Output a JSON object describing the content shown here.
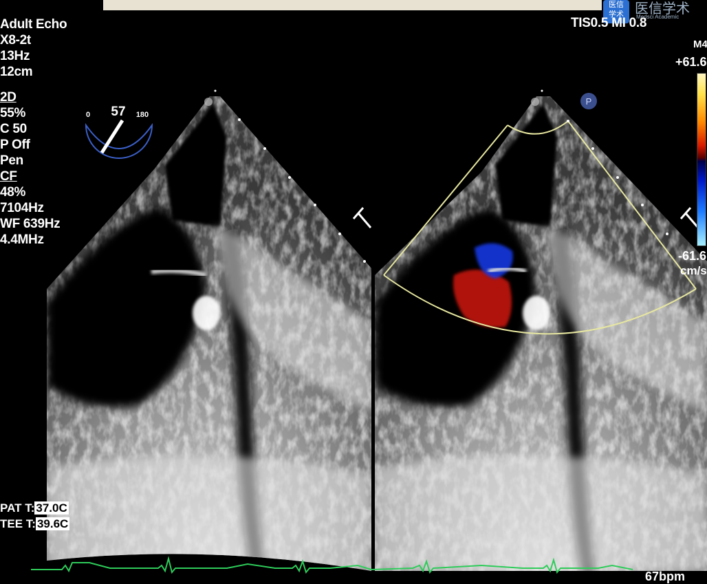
{
  "header": {
    "logo_glyph": "医信学术",
    "logo_text": "医信学术",
    "logo_sub": "Medsci Academic"
  },
  "left_params": {
    "mode": "Adult Echo",
    "probe": "X8-2t",
    "frame_rate": "13Hz",
    "depth": "12cm",
    "section_2d": "2D",
    "gain_2d": " 55%",
    "compress": "C 50",
    "persist": "P Off",
    "resolution": "Pen",
    "section_cf": "CF",
    "gain_cf": " 48%",
    "prf": " 7104Hz",
    "wall_filter": "WF 639Hz",
    "cf_freq": "4.4MHz"
  },
  "top_right": {
    "tis_mi": "TIS0.5   MI 0.8",
    "map": "M4",
    "velocity_top": "+61.6",
    "velocity_bottom": "-61.6",
    "velocity_unit": "cm/s"
  },
  "protractor": {
    "min": "0",
    "angle": "57",
    "max": "180"
  },
  "marker_p": "P",
  "temperatures": {
    "pat_label": "PAT T:",
    "pat_value": "37.0C",
    "tee_label": "TEE T:",
    "tee_value": "39.6C"
  },
  "ecg": {
    "heart_rate": "67bpm",
    "color": "#2ecc5a"
  },
  "colors": {
    "sector_outline": "#e7e7a0",
    "doppler_red": "#c4150f",
    "doppler_blue": "#1538e0"
  }
}
